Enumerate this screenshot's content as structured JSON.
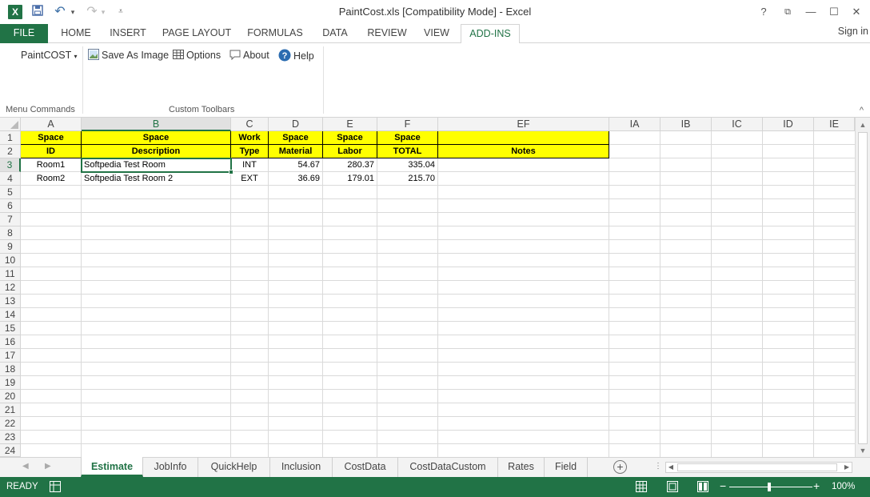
{
  "window": {
    "title": "PaintCost.xls  [Compatibility Mode] - Excel",
    "app_icon": "X",
    "help": "?",
    "minimize": "—",
    "maximize": "☐",
    "close": "✕",
    "restore": "⧉"
  },
  "qat": {
    "save": "💾",
    "undo": "↶",
    "undo_dd": "▾",
    "redo": "↷",
    "redo_dd": "▾",
    "customize": "⩡"
  },
  "tabs": [
    "FILE",
    "HOME",
    "INSERT",
    "PAGE LAYOUT",
    "FORMULAS",
    "DATA",
    "REVIEW",
    "VIEW",
    "ADD-INS"
  ],
  "sign_in": "Sign in",
  "ribbon": {
    "menu": "PaintCOST",
    "menu_arrow": "▾",
    "group1_label": "Menu Commands",
    "save_image": "Save As Image",
    "options": "Options",
    "about": "About",
    "help": "Help",
    "group2_label": "Custom Toolbars",
    "collapse": "^"
  },
  "columns": [
    "A",
    "B",
    "C",
    "D",
    "E",
    "F",
    "EF",
    "IA",
    "IB",
    "IC",
    "ID",
    "IE"
  ],
  "rows": [
    "1",
    "2",
    "3",
    "4",
    "5",
    "6",
    "7",
    "8",
    "9",
    "10",
    "11",
    "12",
    "13",
    "14",
    "15",
    "16",
    "17",
    "18",
    "19",
    "20",
    "21",
    "22",
    "23",
    "24"
  ],
  "cells": {
    "r1": [
      "Space",
      "Space",
      "Work",
      "Space",
      "Space",
      "Space",
      ""
    ],
    "r2": [
      "ID",
      "Description",
      "Type",
      "Material",
      "Labor",
      "TOTAL",
      "Notes"
    ],
    "r3": [
      "Room1",
      "Softpedia Test Room",
      "INT",
      "54.67",
      "280.37",
      "335.04",
      ""
    ],
    "r4": [
      "Room2",
      "Softpedia Test Room 2",
      "EXT",
      "36.69",
      "179.01",
      "215.70",
      ""
    ]
  },
  "sheets": [
    "Estimate",
    "JobInfo",
    "QuickHelp",
    "Inclusion",
    "CostData",
    "CostDataCustom",
    "Rates",
    "Field"
  ],
  "active_sheet": "Estimate",
  "status": {
    "ready": "READY",
    "zoom": "100%",
    "zoom_minus": "−",
    "zoom_plus": "+"
  },
  "colors": {
    "excel_green": "#217346",
    "header_fill": "#ffff00"
  }
}
